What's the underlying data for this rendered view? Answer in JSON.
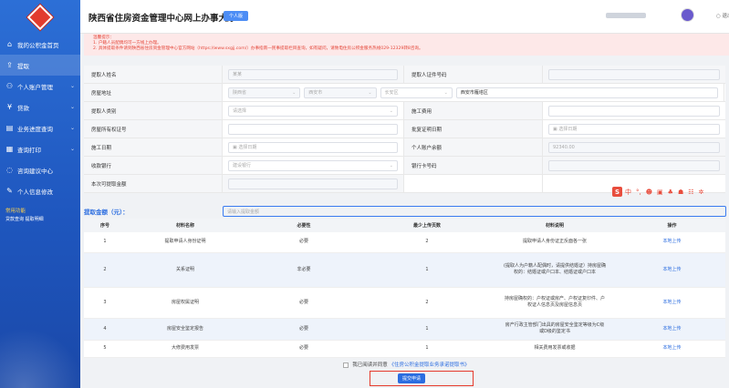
{
  "header": {
    "title": "陕西省住房资金管理中心网上办事大厅",
    "badge": "个人版",
    "exit_label": "○ 退出"
  },
  "sidebar": {
    "items": [
      {
        "icon": "home-icon",
        "glyph": "⌂",
        "label": "我的公积金首页",
        "has_arrow": false
      },
      {
        "icon": "upload-icon",
        "glyph": "⇪",
        "label": "提取",
        "has_arrow": false,
        "active": true
      },
      {
        "icon": "user-icon",
        "glyph": "⚇",
        "label": "个人账户管理",
        "has_arrow": true
      },
      {
        "icon": "money-icon",
        "glyph": "¥",
        "label": "贷款",
        "has_arrow": true
      },
      {
        "icon": "progress-icon",
        "glyph": "▤",
        "label": "业务进度查询",
        "has_arrow": true
      },
      {
        "icon": "print-icon",
        "glyph": "▦",
        "label": "查询打印",
        "has_arrow": true
      },
      {
        "icon": "chat-icon",
        "glyph": "◌",
        "label": "咨询建议中心",
        "has_arrow": false
      },
      {
        "icon": "edit-icon",
        "glyph": "✎",
        "label": "个人信息修改",
        "has_arrow": false
      }
    ],
    "quick": {
      "title": "常用功能",
      "links": "贷款查询 提取明细"
    }
  },
  "notice": {
    "line1": "温馨提示：",
    "line2": "1. 户籍人员配偶均可一方线上办理。",
    "line3": "2. 具体提取条件请到陕西省住房资金管理中心官方网站（https://www.sxgjj.com/）办事指南一民事提取栏目查询，如有疑问，请致电住房公积金服务热线029-12329转8咨询。"
  },
  "form": {
    "rows": [
      {
        "l1": "提取人姓名",
        "v1": "某某",
        "v1_type": "grey",
        "l2": "提取人证件号码",
        "v2": "",
        "v2_type": "grey"
      },
      {
        "l1": "房屋地址",
        "v1_special": "address",
        "l2": "",
        "v2": ""
      },
      {
        "l1": "提取人类别",
        "v1": "请选择",
        "v1_type": "select",
        "l2": "施工费用",
        "v2": "",
        "v2_type": "input"
      },
      {
        "l1": "房屋所有权证号",
        "v1": "",
        "v1_type": "input",
        "l2": "批复证明日期",
        "v2": "选择日期",
        "v2_type": "date"
      },
      {
        "l1": "施工日期",
        "v1": "选择日期",
        "v1_type": "date",
        "l2": "个人账户余额",
        "v2": "92340.00",
        "v2_type": "grey"
      },
      {
        "l1": "收款银行",
        "v1": "建设银行",
        "v1_type": "select",
        "l2": "银行卡号码",
        "v2": "",
        "v2_type": "grey"
      },
      {
        "l1": "本次可提取金额",
        "v1": "",
        "v1_type": "grey",
        "l2": "",
        "v2": "",
        "v2_type": "blank"
      }
    ],
    "address": {
      "province": "陕西省",
      "city": "西安市",
      "district": "长安区",
      "detail": "西安市雁塔区"
    }
  },
  "amount": {
    "label": "提取金额（元）：",
    "placeholder": "请输入提取金额"
  },
  "toolbar": {
    "items": [
      "S",
      "中",
      "°,",
      "☻",
      "▣",
      "♣",
      "☗",
      "☷",
      "✲"
    ]
  },
  "table": {
    "headers": [
      "序号",
      "材料名称",
      "必要性",
      "最少上传页数",
      "材料说明",
      "操作"
    ],
    "rows": [
      {
        "no": "1",
        "name": "提取申请人身份证明",
        "need": "必要",
        "pages": "2",
        "desc": "提取申请人身份证正反面各一张",
        "op": "本地上传"
      },
      {
        "no": "2",
        "name": "关系证明",
        "need": "非必要",
        "pages": "1",
        "desc": "(提取人为户籍人配偶时，请提供结婚证）持房屋确权的：结婚证或户口本、结婚证或户口本",
        "op": "本地上传"
      },
      {
        "no": "3",
        "name": "房屋权属证明",
        "need": "必要",
        "pages": "2",
        "desc": "持房屋确权的：户权证或房产、户权证复印件、户权证人信息页及房屋信息页",
        "op": "本地上传"
      },
      {
        "no": "4",
        "name": "房屋安全鉴定报告",
        "need": "必要",
        "pages": "1",
        "desc": "房产行政主管部门出具的房屋安全鉴定等级为C级或D级的鉴定书",
        "op": "本地上传"
      },
      {
        "no": "5",
        "name": "大修费用发票",
        "need": "必要",
        "pages": "1",
        "desc": "相关费用发票或收据",
        "op": "本地上传"
      }
    ]
  },
  "agreement": {
    "prefix": "我已阅读并同意",
    "link": "《住房公积金提取业务承诺提取书》"
  },
  "submit_label": "提交申请"
}
